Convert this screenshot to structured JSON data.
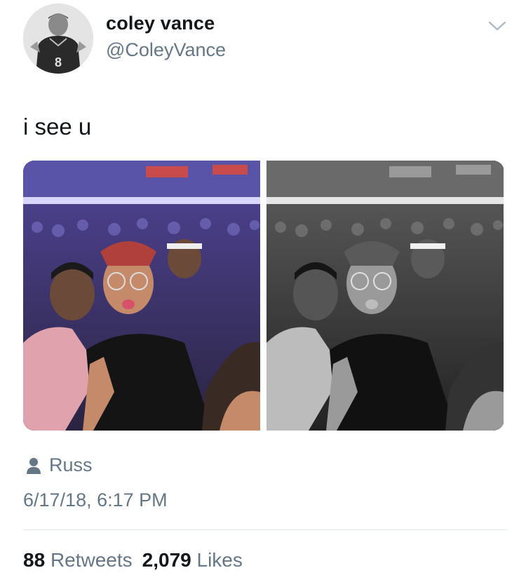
{
  "tweet": {
    "display_name": "coley vance",
    "handle": "@ColeyVance",
    "text": "i see u",
    "avatar_jersey_text": "8",
    "tagged_user": "Russ",
    "timestamp": "6/17/18, 6:17 PM",
    "retweets_count": "88",
    "retweets_label": "Retweets",
    "likes_count": "2,079",
    "likes_label": "Likes"
  },
  "icons": {
    "menu": "chevron-down-icon",
    "tag": "person-icon"
  },
  "colors": {
    "text_primary": "#14171a",
    "text_secondary": "#657786",
    "divider": "#e1e8ed",
    "stage_purple": "#6a63c9"
  }
}
